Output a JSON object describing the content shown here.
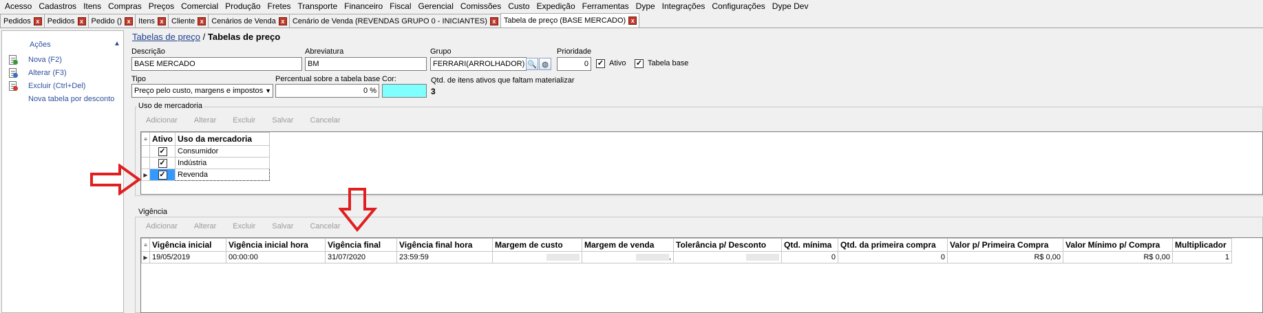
{
  "menu": [
    "Acesso",
    "Cadastros",
    "Itens",
    "Compras",
    "Preços",
    "Comercial",
    "Produção",
    "Fretes",
    "Transporte",
    "Financeiro",
    "Fiscal",
    "Gerencial",
    "Comissões",
    "Custo",
    "Expedição",
    "Ferramentas",
    "Dype",
    "Integrações",
    "Configurações",
    "Dype Dev"
  ],
  "tabs": [
    {
      "label": "Pedidos",
      "close": "x"
    },
    {
      "label": "Pedidos",
      "close": "x"
    },
    {
      "label": "Pedido ()",
      "close": "x"
    },
    {
      "label": "Itens",
      "close": "x"
    },
    {
      "label": "Cliente",
      "close": "x"
    },
    {
      "label": "Cenários de Venda",
      "close": "x"
    },
    {
      "label": "Cenário de Venda (REVENDAS GRUPO 0 - INICIANTES)",
      "close": "x"
    },
    {
      "label": "Tabela de preço (BASE MERCADO)",
      "close": "x",
      "active": true
    }
  ],
  "sidebar": {
    "title": "Ações",
    "items": [
      {
        "label": "Nova (F2)",
        "icon": "new-document-icon"
      },
      {
        "label": "Alterar (F3)",
        "icon": "edit-document-icon"
      },
      {
        "label": "Excluir (Ctrl+Del)",
        "icon": "delete-document-icon"
      },
      {
        "label": "Nova tabela por desconto",
        "icon": ""
      }
    ]
  },
  "breadcrumb": {
    "link": "Tabelas de preço",
    "sep": "/",
    "current": "Tabelas de preço"
  },
  "form": {
    "descricao": {
      "label": "Descrição",
      "value": "BASE MERCADO"
    },
    "abreviatura": {
      "label": "Abreviatura",
      "value": "BM"
    },
    "grupo": {
      "label": "Grupo",
      "value": "FERRARI(ARROLHADOR)"
    },
    "prioridade": {
      "label": "Prioridade",
      "value": "0"
    },
    "ativo": {
      "label": "Ativo",
      "checked": true
    },
    "tabela_base": {
      "label": "Tabela base",
      "checked": true
    },
    "tipo": {
      "label": "Tipo",
      "value": "Preço pelo custo, margens e impostos"
    },
    "percentual": {
      "label": "Percentual sobre a tabela base",
      "value": "0 %"
    },
    "cor": {
      "label": "Cor:",
      "color": "#80ffff"
    },
    "qtd_itens": {
      "label": "Qtd. de itens ativos que faltam materializar",
      "value": "3"
    }
  },
  "uso_mercadoria": {
    "title": "Uso de mercadoria",
    "toolbar": [
      "Adicionar",
      "Alterar",
      "Excluir",
      "Salvar",
      "Cancelar"
    ],
    "columns": [
      "Ativo",
      "Uso da mercadoria"
    ],
    "rows": [
      {
        "ativo": true,
        "uso": "Consumidor"
      },
      {
        "ativo": true,
        "uso": "Indústria"
      },
      {
        "ativo": true,
        "uso": "Revenda",
        "selected": true
      }
    ]
  },
  "vigencia": {
    "title": "Vigência",
    "toolbar": [
      "Adicionar",
      "Alterar",
      "Excluir",
      "Salvar",
      "Cancelar"
    ],
    "columns": [
      "Vigência inicial",
      "Vigência inicial hora",
      "Vigência final",
      "Vigência final hora",
      "Margem de custo",
      "Margem de venda",
      "Tolerância p/ Desconto",
      "Qtd. mínima",
      "Qtd. da primeira compra",
      "Valor p/ Primeira Compra",
      "Valor Mínimo p/ Compra",
      "Multiplicador"
    ],
    "rows": [
      [
        "19/05/2019",
        "00:00:00",
        "31/07/2020",
        "23:59:59",
        "",
        ",",
        "",
        "0",
        "0",
        "R$ 0,00",
        "R$ 0,00",
        "1"
      ]
    ]
  },
  "colors": {
    "accent_link": "#2d4f9e",
    "tab_close": "#c03a2b",
    "arrow": "#e02020"
  }
}
